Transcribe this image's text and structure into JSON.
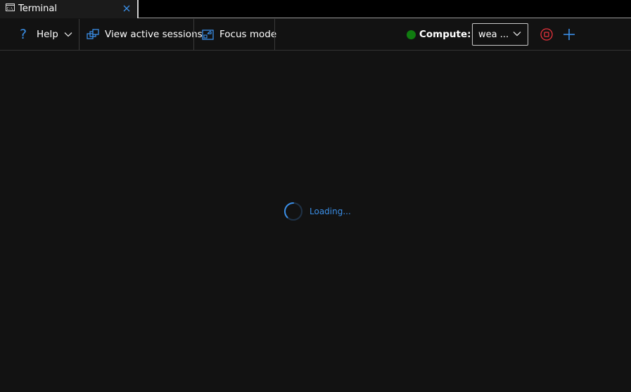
{
  "tab": {
    "label": "Terminal",
    "icon": "terminal-icon",
    "icon_text": "C:\\",
    "close_icon": "close-icon"
  },
  "toolbar": {
    "help_label": "Help",
    "help_icon": "question-icon",
    "view_sessions_label": "View active sessions",
    "view_sessions_icon": "sessions-icon",
    "focus_mode_label": "Focus mode",
    "focus_mode_icon": "focus-icon",
    "compute_label": "Compute:",
    "compute_status_color": "#107c10",
    "compute_value": "wea ...",
    "stop_icon": "stop-icon",
    "add_icon": "add-icon"
  },
  "main": {
    "loading_text": "Loading..."
  },
  "colors": {
    "accent": "#3a8ee6",
    "stop": "#e8323c",
    "background": "#121212"
  }
}
